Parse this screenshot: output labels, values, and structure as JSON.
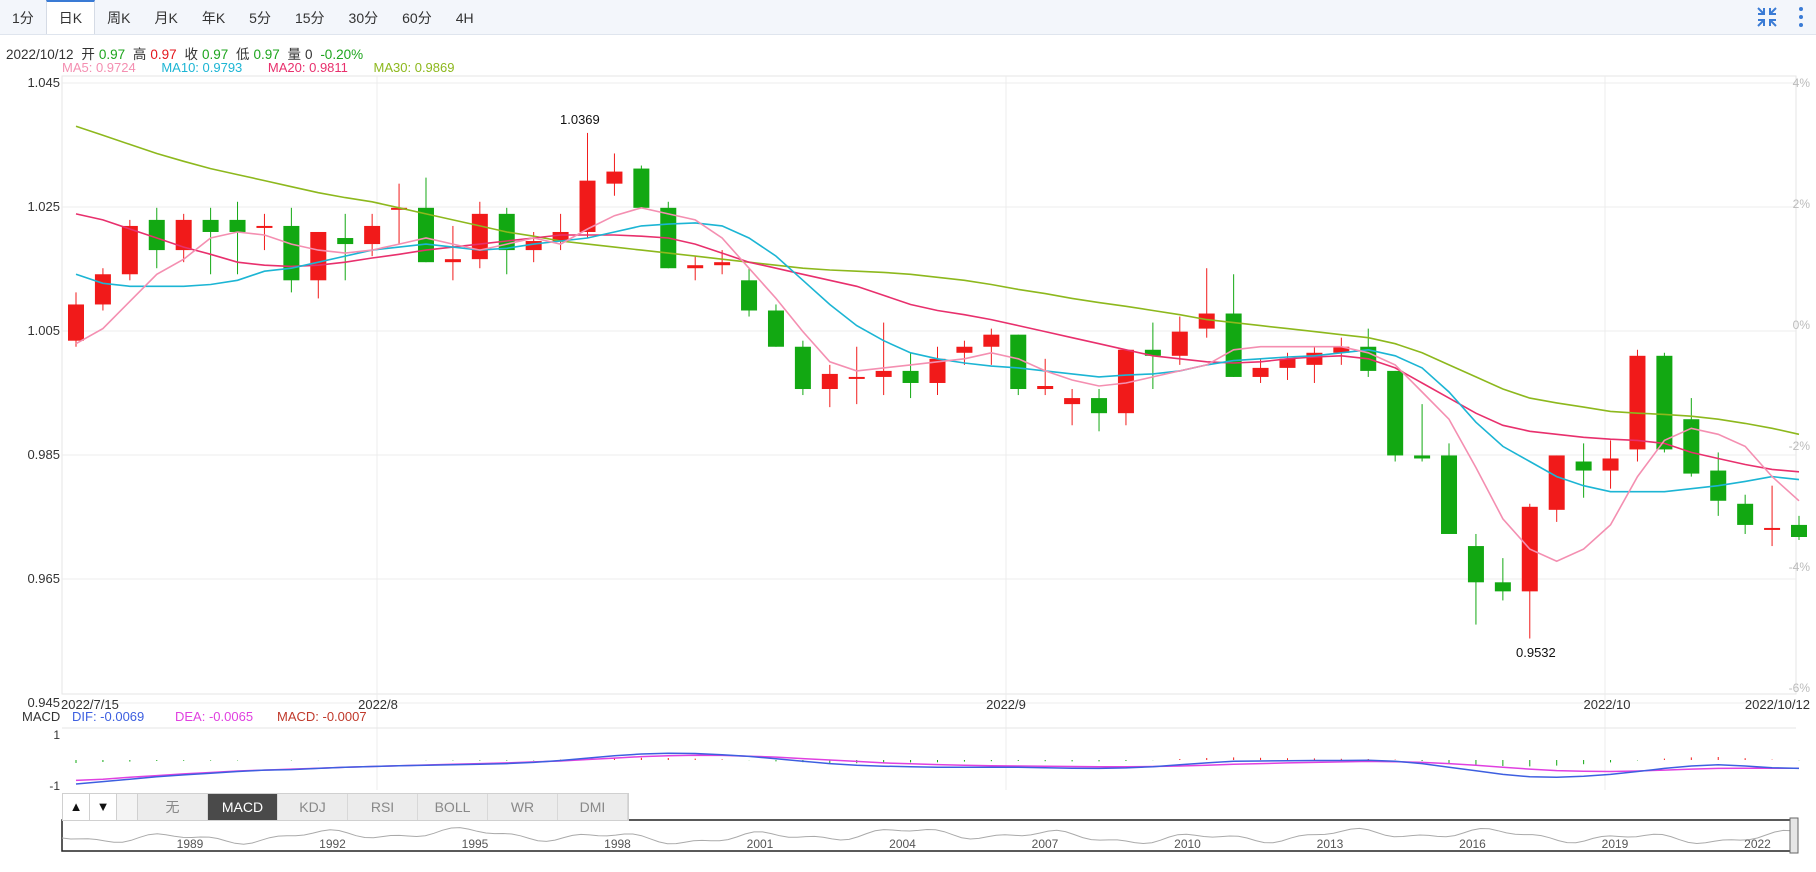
{
  "tabs": [
    "1分",
    "日K",
    "周K",
    "月K",
    "年K",
    "5分",
    "15分",
    "30分",
    "60分",
    "4H"
  ],
  "active_tab": "日K",
  "icons": {
    "collapse": "collapse-arrows-icon",
    "more": "vertical-dots-icon"
  },
  "info": {
    "date": "2022/10/12",
    "open_label": "开",
    "open": "0.97",
    "high_label": "高",
    "high": "0.97",
    "close_label": "收",
    "close": "0.97",
    "low_label": "低",
    "low": "0.97",
    "vol_label": "量",
    "vol": "0",
    "change": "-0.20%"
  },
  "ma": {
    "ma5": "MA5: 0.9724",
    "ma10": "MA10: 0.9793",
    "ma20": "MA20: 0.9811",
    "ma30": "MA30: 0.9869"
  },
  "colors": {
    "up": "#f11a1a",
    "down": "#12a812",
    "ma5": "#f48fb1",
    "ma10": "#1cb5d4",
    "ma20": "#e8306d",
    "ma30": "#8db81d",
    "dif": "#3d5fe0",
    "dea": "#e040e0",
    "macd_label": "#c0392b",
    "grid": "#ececec"
  },
  "indicator_tabs": [
    "无",
    "MACD",
    "KDJ",
    "RSI",
    "BOLL",
    "WR",
    "DMI"
  ],
  "active_indicator": "MACD",
  "arrows": [
    "▲",
    "▼"
  ],
  "chart_data": {
    "type": "candlestick",
    "y_axis_labels": [
      "1.045",
      "1.025",
      "1.005",
      "0.985",
      "0.965",
      "0.945"
    ],
    "y_range": [
      0.945,
      1.045
    ],
    "pct_axis_labels": [
      "4%",
      "2%",
      "0%",
      "-2%",
      "-4%",
      "-6%"
    ],
    "date_labels": [
      "2022/7/15",
      "2022/8",
      "2022/9",
      "2022/10",
      "2022/10/12"
    ],
    "annotations": {
      "high": "1.0369",
      "low": "0.9532"
    },
    "candles": [
      [
        1.0025,
        1.0105,
        1.0015,
        1.0085
      ],
      [
        1.0085,
        1.0145,
        1.0075,
        1.0135
      ],
      [
        1.0135,
        1.0225,
        1.0125,
        1.0215
      ],
      [
        1.0225,
        1.0245,
        1.0145,
        1.0175
      ],
      [
        1.0175,
        1.0235,
        1.0155,
        1.0225
      ],
      [
        1.0225,
        1.0245,
        1.0135,
        1.0205
      ],
      [
        1.0225,
        1.0255,
        1.0135,
        1.0205
      ],
      [
        1.0215,
        1.0235,
        1.0175,
        1.0215
      ],
      [
        1.0215,
        1.0245,
        1.0105,
        1.0125
      ],
      [
        1.0125,
        1.0205,
        1.0095,
        1.0205
      ],
      [
        1.0195,
        1.0235,
        1.0125,
        1.0185
      ],
      [
        1.0185,
        1.0235,
        1.0165,
        1.0215
      ],
      [
        1.0245,
        1.0285,
        1.0185,
        1.0245
      ],
      [
        1.0245,
        1.0295,
        1.0155,
        1.0155
      ],
      [
        1.0155,
        1.0215,
        1.0125,
        1.016
      ],
      [
        1.016,
        1.0255,
        1.0145,
        1.0235
      ],
      [
        1.0235,
        1.0245,
        1.0135,
        1.0175
      ],
      [
        1.0175,
        1.0205,
        1.0155,
        1.019
      ],
      [
        1.019,
        1.0235,
        1.0175,
        1.0205
      ],
      [
        1.0205,
        1.0369,
        1.0195,
        1.029
      ],
      [
        1.0285,
        1.0335,
        1.0265,
        1.0305
      ],
      [
        1.031,
        1.0315,
        1.0245,
        1.0245
      ],
      [
        1.0245,
        1.0255,
        1.0145,
        1.0145
      ],
      [
        1.0145,
        1.0165,
        1.0125,
        1.015
      ],
      [
        1.015,
        1.0175,
        1.0135,
        1.0155
      ],
      [
        1.0125,
        1.0145,
        1.0065,
        1.0075
      ],
      [
        1.0075,
        1.0085,
        1.0015,
        1.0015
      ],
      [
        1.0015,
        1.0025,
        0.9935,
        0.9945
      ],
      [
        0.9945,
        0.9985,
        0.9915,
        0.997
      ],
      [
        0.9965,
        1.0015,
        0.992,
        0.9965
      ],
      [
        0.9965,
        1.0055,
        0.9935,
        0.9975
      ],
      [
        0.9975,
        1.0005,
        0.993,
        0.9955
      ],
      [
        0.9955,
        1.0015,
        0.9935,
        0.9995
      ],
      [
        1.0005,
        1.0025,
        0.9985,
        1.0015
      ],
      [
        1.0015,
        1.0045,
        0.9985,
        1.0035
      ],
      [
        1.0035,
        1.0035,
        0.9935,
        0.9945
      ],
      [
        0.9945,
        0.9995,
        0.9935,
        0.995
      ],
      [
        0.992,
        0.9945,
        0.9885,
        0.993
      ],
      [
        0.993,
        0.9945,
        0.9875,
        0.9905
      ],
      [
        0.9905,
        1.0005,
        0.9885,
        1.001
      ],
      [
        1.001,
        1.0055,
        0.9945,
        1.0
      ],
      [
        1.0,
        1.0065,
        0.9985,
        1.004
      ],
      [
        1.0045,
        1.0145,
        1.003,
        1.007
      ],
      [
        1.007,
        1.0135,
        0.9965,
        0.9965
      ],
      [
        0.9965,
        0.9995,
        0.9955,
        0.998
      ],
      [
        0.998,
        1.0005,
        0.996,
        0.9995
      ],
      [
        0.9985,
        1.0015,
        0.9955,
        1.0005
      ],
      [
        1.0005,
        1.003,
        0.9985,
        1.0015
      ],
      [
        1.0015,
        1.0045,
        0.9965,
        0.9975
      ],
      [
        0.9975,
        0.9975,
        0.9825,
        0.9835
      ],
      [
        0.9835,
        0.992,
        0.9825,
        0.983
      ],
      [
        0.9835,
        0.9855,
        0.9705,
        0.9705
      ],
      [
        0.9685,
        0.9705,
        0.9555,
        0.9625
      ],
      [
        0.9625,
        0.9665,
        0.9595,
        0.961
      ],
      [
        0.961,
        0.9755,
        0.9532,
        0.975
      ],
      [
        0.9745,
        0.9835,
        0.9725,
        0.9835
      ],
      [
        0.9825,
        0.9855,
        0.9765,
        0.981
      ],
      [
        0.981,
        0.986,
        0.978,
        0.983
      ],
      [
        0.9845,
        1.001,
        0.9825,
        1.0
      ],
      [
        1.0,
        1.0005,
        0.984,
        0.9845
      ],
      [
        0.9895,
        0.993,
        0.98,
        0.9805
      ],
      [
        0.981,
        0.984,
        0.9735,
        0.976
      ],
      [
        0.9755,
        0.977,
        0.9705,
        0.972
      ],
      [
        0.9715,
        0.9785,
        0.9685,
        0.9715
      ],
      [
        0.972,
        0.9735,
        0.9695,
        0.97
      ]
    ],
    "ma5": [
      1.002,
      1.0045,
      1.009,
      1.0135,
      1.016,
      1.0195,
      1.0205,
      1.02,
      1.0185,
      1.0175,
      1.017,
      1.0175,
      1.0185,
      1.0195,
      1.0185,
      1.0175,
      1.0185,
      1.0195,
      1.0185,
      1.021,
      1.0232,
      1.0245,
      1.0235,
      1.0225,
      1.0195,
      1.0145,
      1.0095,
      1.004,
      0.999,
      0.9975,
      0.998,
      0.9985,
      0.999,
      0.9995,
      1.0005,
      0.9995,
      0.9975,
      0.996,
      0.995,
      0.9955,
      0.9965,
      0.9975,
      0.9985,
      1.001,
      1.0015,
      1.0015,
      1.0015,
      1.0015,
      1.0005,
      0.9985,
      0.994,
      0.9895,
      0.9815,
      0.973,
      0.968,
      0.966,
      0.968,
      0.972,
      0.98,
      0.986,
      0.988,
      0.987,
      0.985,
      0.98,
      0.976
    ],
    "ma10": [
      1.0135,
      1.012,
      1.0115,
      1.0115,
      1.0115,
      1.0118,
      1.0125,
      1.014,
      1.0145,
      1.0155,
      1.0165,
      1.0175,
      1.018,
      1.0185,
      1.018,
      1.0175,
      1.0178,
      1.0185,
      1.019,
      1.0195,
      1.0205,
      1.0215,
      1.0218,
      1.022,
      1.0215,
      1.0195,
      1.0165,
      1.0125,
      1.0085,
      1.005,
      1.0025,
      1.0005,
      0.9995,
      0.9988,
      0.9983,
      0.998,
      0.9975,
      0.997,
      0.9965,
      0.9968,
      0.997,
      0.9975,
      0.9985,
      0.9992,
      0.9995,
      0.9998,
      1.0,
      1.0005,
      1.001,
      1.0,
      0.998,
      0.994,
      0.989,
      0.985,
      0.9825,
      0.98,
      0.9785,
      0.9775,
      0.9775,
      0.9775,
      0.978,
      0.9785,
      0.9792,
      0.98,
      0.9795
    ],
    "ma20": [
      1.0235,
      1.0225,
      1.021,
      1.0195,
      1.018,
      1.0168,
      1.0155,
      1.015,
      1.0148,
      1.015,
      1.0155,
      1.0162,
      1.0168,
      1.0175,
      1.018,
      1.0185,
      1.019,
      1.0195,
      1.02,
      1.02,
      1.02,
      1.0198,
      1.0195,
      1.0185,
      1.017,
      1.0155,
      1.0145,
      1.0135,
      1.0125,
      1.0115,
      1.01,
      1.0085,
      1.0075,
      1.0068,
      1.006,
      1.005,
      1.004,
      1.003,
      1.002,
      1.001,
      1.0,
      0.9995,
      0.999,
      0.9988,
      0.999,
      0.9995,
      0.9998,
      1.0,
      0.9995,
      0.998,
      0.9955,
      0.993,
      0.9905,
      0.9885,
      0.9875,
      0.987,
      0.9865,
      0.9862,
      0.986,
      0.9855,
      0.984,
      0.983,
      0.982,
      0.9812,
      0.9808
    ],
    "ma30": [
      1.038,
      1.0365,
      1.035,
      1.0335,
      1.0322,
      1.031,
      1.03,
      1.029,
      1.028,
      1.027,
      1.0262,
      1.0255,
      1.0245,
      1.0235,
      1.0225,
      1.0215,
      1.0205,
      1.0198,
      1.019,
      1.0185,
      1.018,
      1.0175,
      1.017,
      1.0165,
      1.016,
      1.0155,
      1.015,
      1.0145,
      1.0142,
      1.014,
      1.0138,
      1.0135,
      1.013,
      1.0125,
      1.0118,
      1.011,
      1.0103,
      1.0095,
      1.0088,
      1.0082,
      1.0075,
      1.0068,
      1.006,
      1.0055,
      1.005,
      1.0045,
      1.004,
      1.0035,
      1.003,
      1.002,
      1.0005,
      0.9985,
      0.9965,
      0.9945,
      0.993,
      0.9922,
      0.9915,
      0.9908,
      0.9905,
      0.9903,
      0.99,
      0.9895,
      0.9888,
      0.988,
      0.987
    ],
    "macd": {
      "dif_label": "DIF: -0.0069",
      "dea_label": "DEA: -0.0065",
      "macd_label": "MACD: -0.0007",
      "title": "MACD",
      "y_labels": [
        "1",
        "-1"
      ],
      "dif": [
        -1.0,
        -0.9,
        -0.8,
        -0.7,
        -0.62,
        -0.55,
        -0.48,
        -0.42,
        -0.4,
        -0.35,
        -0.3,
        -0.27,
        -0.24,
        -0.22,
        -0.2,
        -0.18,
        -0.15,
        -0.1,
        -0.02,
        0.08,
        0.18,
        0.25,
        0.28,
        0.27,
        0.22,
        0.15,
        0.05,
        -0.05,
        -0.15,
        -0.22,
        -0.26,
        -0.28,
        -0.3,
        -0.3,
        -0.3,
        -0.3,
        -0.32,
        -0.34,
        -0.35,
        -0.33,
        -0.28,
        -0.2,
        -0.12,
        -0.05,
        -0.04,
        -0.03,
        -0.02,
        -0.02,
        -0.01,
        -0.05,
        -0.15,
        -0.3,
        -0.45,
        -0.6,
        -0.7,
        -0.72,
        -0.68,
        -0.6,
        -0.48,
        -0.35,
        -0.25,
        -0.2,
        -0.25,
        -0.32,
        -0.35
      ],
      "dea": [
        -0.85,
        -0.8,
        -0.72,
        -0.65,
        -0.58,
        -0.52,
        -0.46,
        -0.42,
        -0.38,
        -0.34,
        -0.3,
        -0.27,
        -0.24,
        -0.21,
        -0.18,
        -0.15,
        -0.12,
        -0.08,
        -0.04,
        0.02,
        0.08,
        0.14,
        0.18,
        0.2,
        0.19,
        0.16,
        0.12,
        0.06,
        0.0,
        -0.06,
        -0.12,
        -0.16,
        -0.19,
        -0.22,
        -0.24,
        -0.25,
        -0.26,
        -0.27,
        -0.28,
        -0.28,
        -0.27,
        -0.25,
        -0.22,
        -0.18,
        -0.15,
        -0.12,
        -0.1,
        -0.08,
        -0.06,
        -0.07,
        -0.1,
        -0.15,
        -0.22,
        -0.3,
        -0.38,
        -0.44,
        -0.47,
        -0.48,
        -0.46,
        -0.42,
        -0.38,
        -0.35,
        -0.34,
        -0.34,
        -0.34
      ]
    },
    "navigator_years": [
      "1989",
      "1992",
      "1995",
      "1998",
      "2001",
      "2004",
      "2007",
      "2010",
      "2013",
      "2016",
      "2019",
      "2022"
    ]
  }
}
